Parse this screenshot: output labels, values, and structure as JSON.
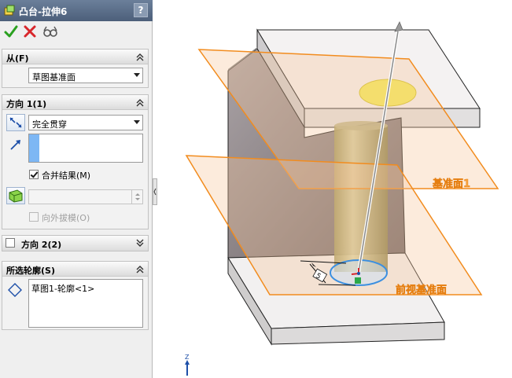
{
  "feature": {
    "title": "凸台-拉伸6",
    "help_label": "?"
  },
  "actions": {
    "ok_icon": "check-icon",
    "cancel_icon": "x-icon",
    "preview_icon": "glasses-icon"
  },
  "from_group": {
    "title": "从(F)",
    "selected": "草图基准面"
  },
  "direction1_group": {
    "title": "方向 1(1)",
    "end_condition": "完全贯穿",
    "merge_label": "合并结果(M)",
    "merge_checked": true,
    "draft_label": "向外拔模(O)",
    "draft_enabled": false,
    "draft_value": ""
  },
  "direction2_group": {
    "title": "方向 2(2)",
    "checked": false
  },
  "contours_group": {
    "title": "所选轮廓(S)",
    "items": [
      "草图1-轮廓<1>"
    ]
  },
  "viewport": {
    "plane_labels": [
      "基准面1",
      "前视基准面"
    ],
    "dimension_label": "5",
    "triad_axis_label": "Z"
  },
  "colors": {
    "plane_orange": "#f28c1e",
    "accent_blue": "#4a8fe0",
    "sketch_yellow": "#f3ec3a"
  }
}
